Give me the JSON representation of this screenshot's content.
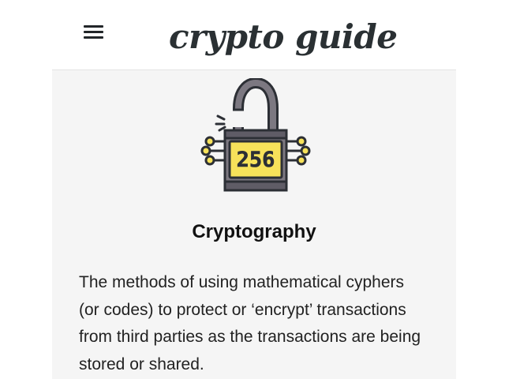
{
  "header": {
    "menu_icon": "hamburger-menu-icon",
    "logo_text": "crypto guide"
  },
  "card": {
    "image_icon": "padlock-256-icon",
    "image_text": "256",
    "title": "Cryptography",
    "description": "The methods of using mathematical cyphers (or codes) to protect or ‘encrypt’ transactions from third parties as the transactions are being stored or shared."
  },
  "colors": {
    "background": "#ffffff",
    "card_background": "#f5f5f5",
    "text": "#222222",
    "logo": "#2a3033",
    "lock_yellow": "#f7e25a",
    "lock_dark": "#2c2f35",
    "lock_gray": "#7c7881"
  }
}
